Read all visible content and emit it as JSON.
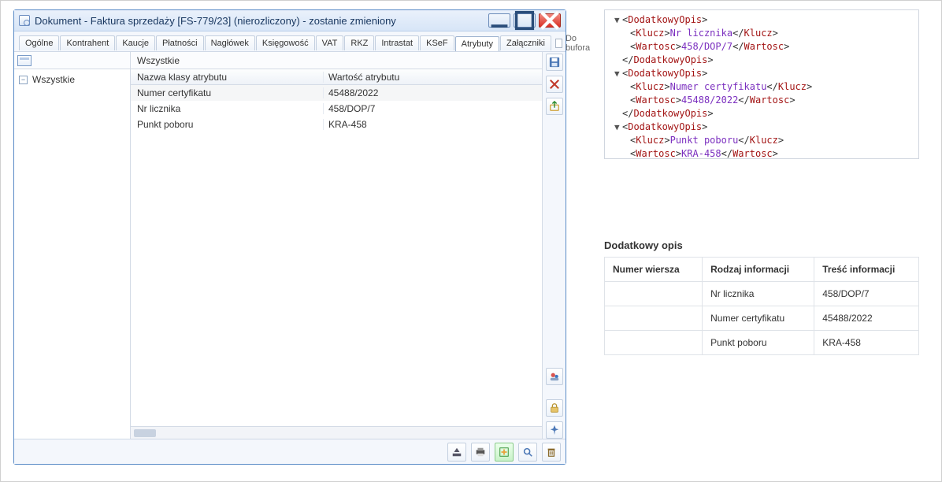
{
  "window": {
    "title": "Dokument - Faktura sprzedaży [FS-779/23] (nierozliczony) - zostanie zmieniony"
  },
  "tabs": {
    "items": [
      "Ogólne",
      "Kontrahent",
      "Kaucje",
      "Płatności",
      "Nagłówek",
      "Księgowość",
      "VAT",
      "RKZ",
      "Intrastat",
      "KSeF",
      "Atrybuty",
      "Załączniki"
    ],
    "active_index": 10,
    "buffer_label": "Do bufora"
  },
  "tree": {
    "header_alt": "widok",
    "root": "Wszystkie"
  },
  "grid": {
    "title": "Wszystkie",
    "col1": "Nazwa klasy atrybutu",
    "col2": "Wartość atrybutu",
    "rows": [
      {
        "name": "Numer certyfikatu",
        "value": "45488/2022",
        "selected": true
      },
      {
        "name": "Nr licznika",
        "value": "458/DOP/7",
        "selected": false
      },
      {
        "name": "Punkt poboru",
        "value": "KRA-458",
        "selected": false
      }
    ]
  },
  "xml": {
    "nodes": [
      {
        "key": "Nr licznika",
        "value": "458/DOP/7"
      },
      {
        "key": "Numer certyfikatu",
        "value": "45488/2022"
      },
      {
        "key": "Punkt poboru",
        "value": "KRA-458"
      }
    ],
    "tags": {
      "wrap": "DodatkowyOpis",
      "k": "Klucz",
      "v": "Wartosc"
    }
  },
  "extra": {
    "title": "Dodatkowy opis",
    "h1": "Numer wiersza",
    "h2": "Rodzaj informacji",
    "h3": "Treść informacji",
    "rows": [
      {
        "num": "",
        "kind": "Nr licznika",
        "val": "458/DOP/7"
      },
      {
        "num": "",
        "kind": "Numer certyfikatu",
        "val": "45488/2022"
      },
      {
        "num": "",
        "kind": "Punkt poboru",
        "val": "KRA-458"
      }
    ]
  }
}
